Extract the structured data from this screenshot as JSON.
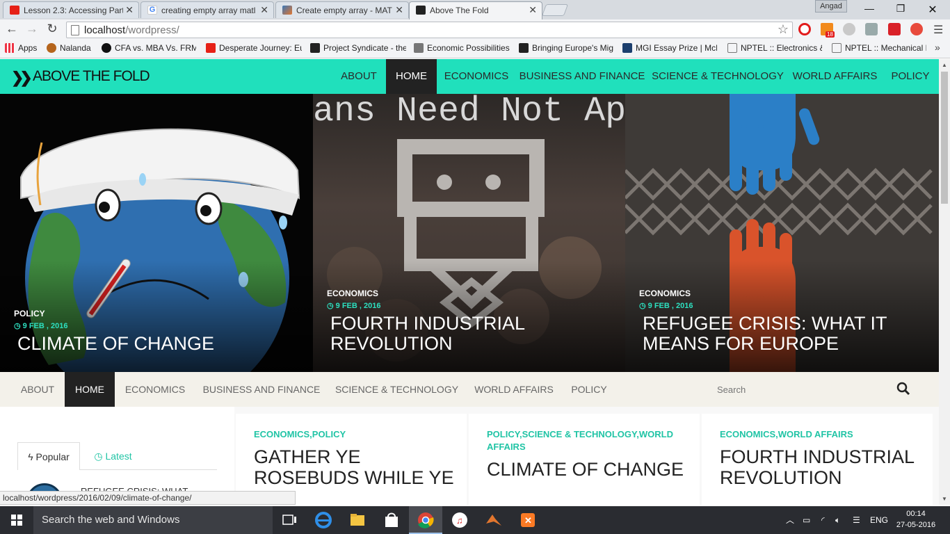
{
  "browser": {
    "tabs": [
      {
        "title": "Lesson 2.3: Accessing Part",
        "icon": "youtube-icon",
        "color": "#e62117"
      },
      {
        "title": "creating empty array matl",
        "icon": "google-icon",
        "color": "#4285f4"
      },
      {
        "title": "Create empty array - MAT",
        "icon": "matlab-icon",
        "color": "#e2762e"
      },
      {
        "title": "Above The Fold",
        "icon": "site-icon",
        "color": "#222222"
      }
    ],
    "profile_name": "Angad",
    "url_host": "localhost",
    "url_path": "/wordpress/",
    "extension_badge": "18",
    "bookmarks": [
      {
        "label": "Apps",
        "icon": "apps-icon"
      },
      {
        "label": "Nalanda",
        "icon": "nalanda-icon"
      },
      {
        "label": "CFA vs. MBA Vs. FRM:",
        "icon": "g-icon"
      },
      {
        "label": "Desperate Journey: Eu",
        "icon": "youtube-icon"
      },
      {
        "label": "Project Syndicate - the",
        "icon": "ps-icon"
      },
      {
        "label": "Economic Possibilities",
        "icon": "doc-icon"
      },
      {
        "label": "Bringing Europe's Mig",
        "icon": "ps-icon"
      },
      {
        "label": "MGI Essay Prize | McK",
        "icon": "mgi-icon"
      },
      {
        "label": "NPTEL :: Electronics &",
        "icon": "page-icon"
      },
      {
        "label": "NPTEL :: Mechanical E",
        "icon": "page-icon"
      }
    ],
    "status_url": "localhost/wordpress/2016/02/09/climate-of-change/"
  },
  "site": {
    "brand": "ABOVE THE FOLD",
    "accent": "#20e0bc",
    "nav": [
      "ABOUT",
      "HOME",
      "ECONOMICS",
      "BUSINESS AND FINANCE",
      "SCIENCE & TECHNOLOGY",
      "WORLD AFFAIRS",
      "POLICY"
    ],
    "active_nav": "HOME",
    "search_placeholder": "Search"
  },
  "slides": [
    {
      "category": "POLICY",
      "date": "9 FEB , 2016",
      "title": "CLIMATE OF CHANGE"
    },
    {
      "category": "ECONOMICS",
      "date": "9 FEB , 2016",
      "title": "FOURTH INDUSTRIAL REVOLUTION",
      "backdrop_text": "ans Need Not Ap"
    },
    {
      "category": "ECONOMICS",
      "date": "9 FEB , 2016",
      "title": "REFUGEE CRISIS: WHAT IT MEANS FOR EUROPE"
    }
  ],
  "sidebar": {
    "tabs": [
      "Popular",
      "Latest"
    ],
    "first_item_title": "REFUGEE CRISIS: WHAT"
  },
  "posts": [
    {
      "categories": "ECONOMICS,POLICY",
      "title": "GATHER YE ROSEBUDS WHILE YE MAY"
    },
    {
      "categories": "POLICY,SCIENCE & TECHNOLOGY,WORLD AFFAIRS",
      "title": "CLIMATE OF CHANGE"
    },
    {
      "categories": "ECONOMICS,WORLD AFFAIRS",
      "title": "FOURTH INDUSTRIAL REVOLUTION"
    }
  ],
  "taskbar": {
    "search_placeholder": "Search the web and Windows",
    "language": "ENG",
    "time": "00:14",
    "date": "27-05-2016"
  }
}
